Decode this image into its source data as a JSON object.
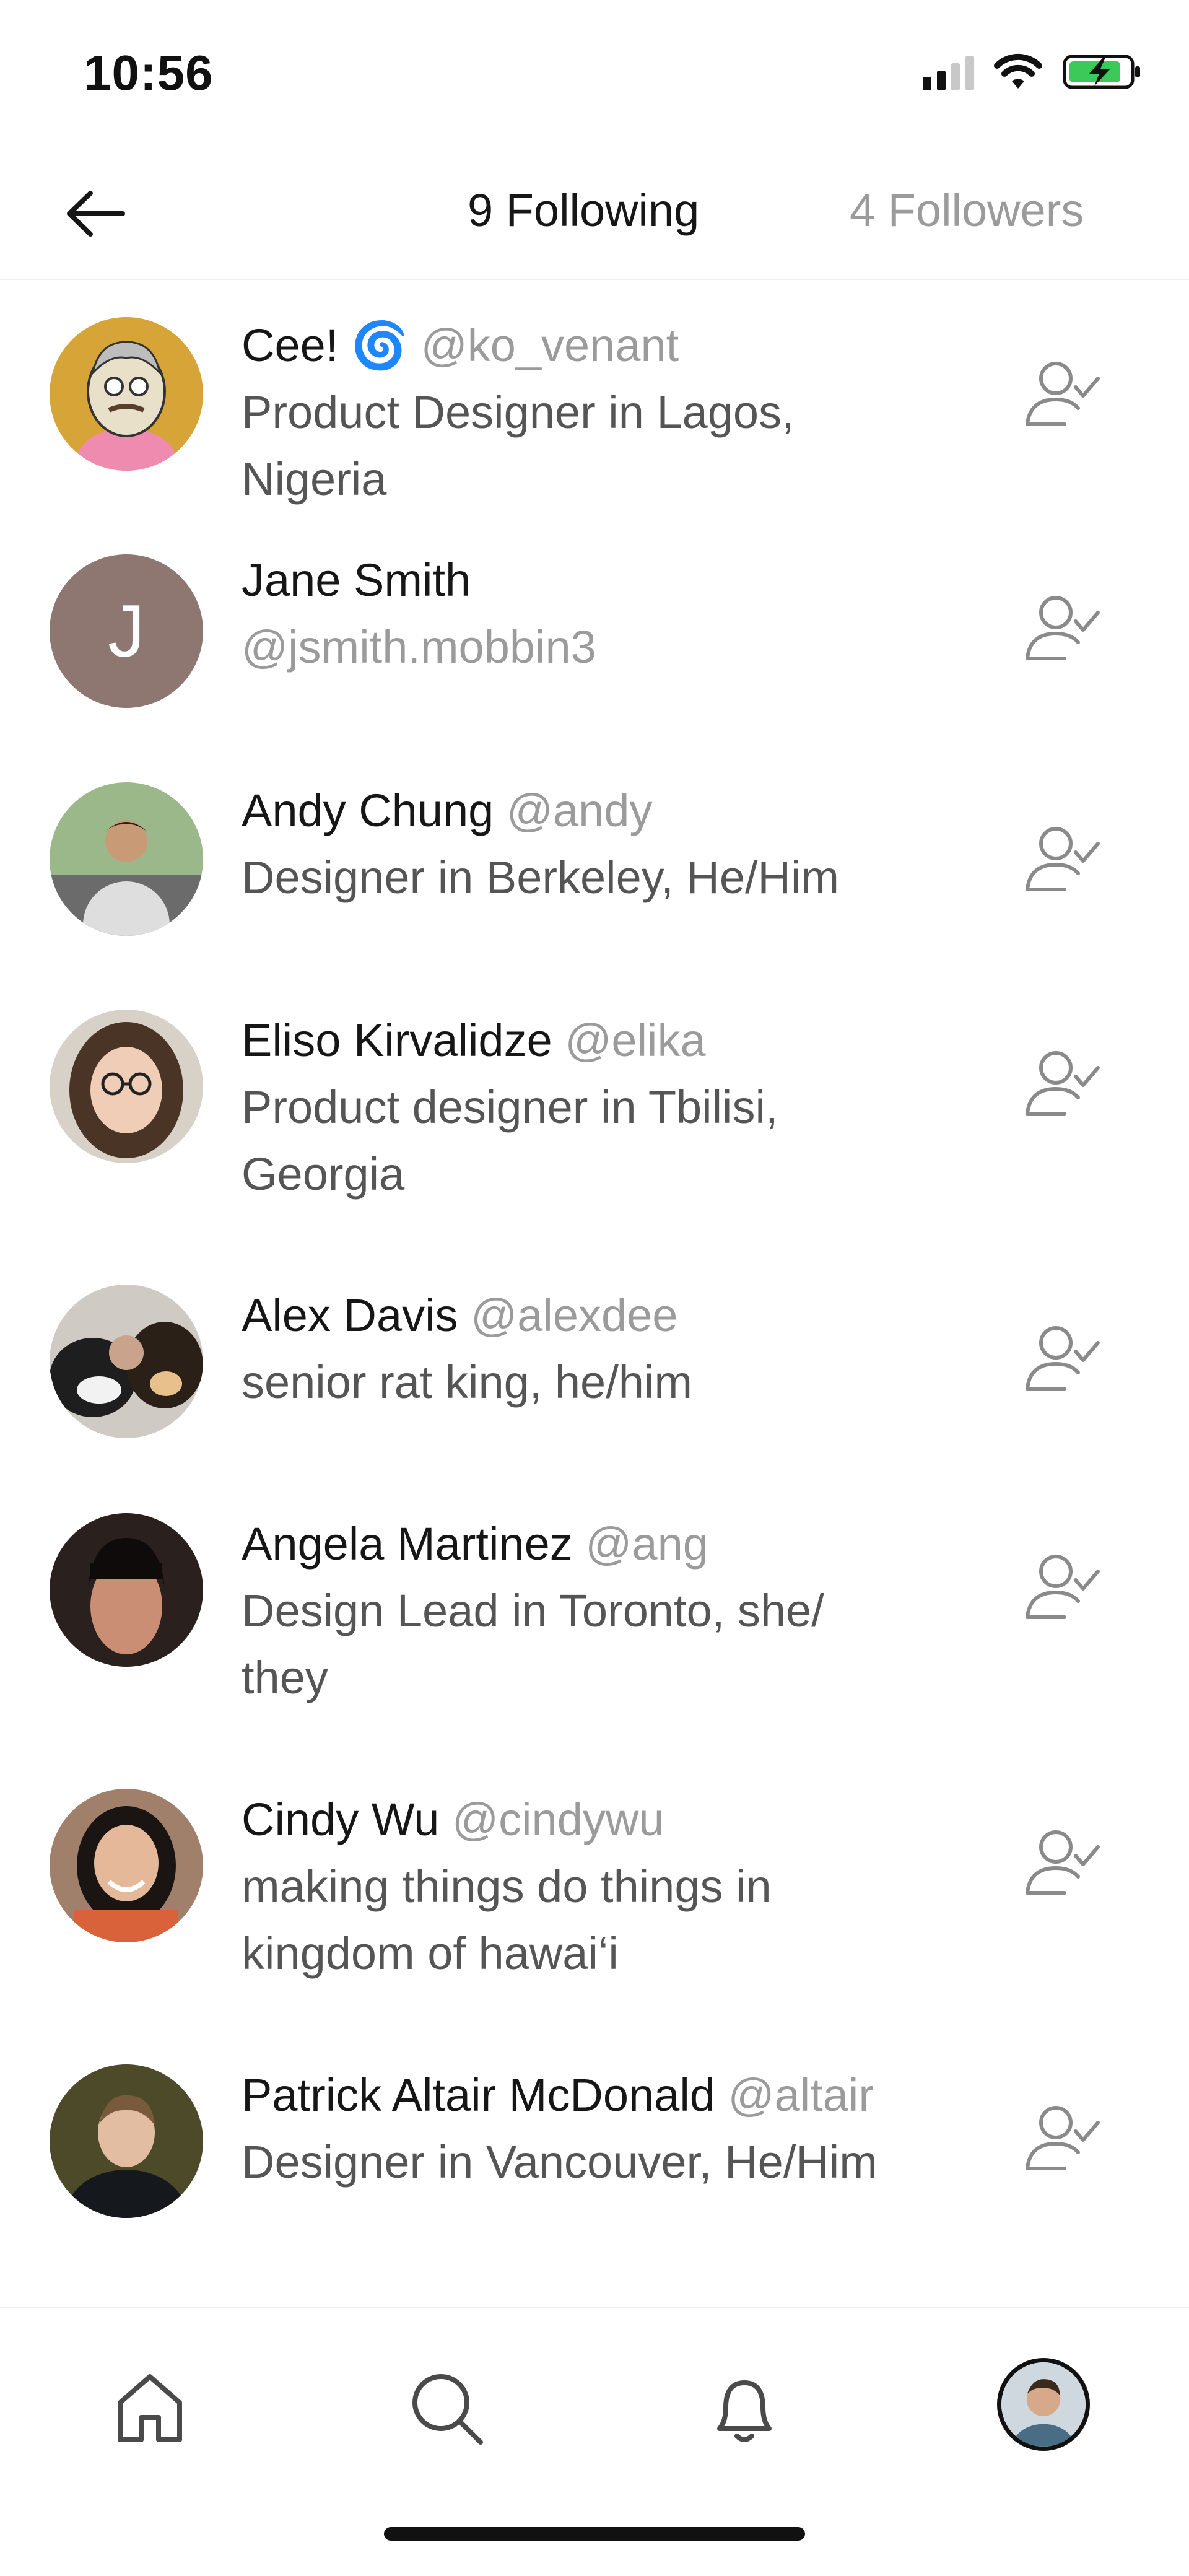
{
  "status_bar": {
    "time": "10:56",
    "signal_icon": "cellular-signal-icon",
    "wifi_icon": "wifi-icon",
    "battery_icon": "battery-charging-icon"
  },
  "header": {
    "back_icon": "arrow-left-icon",
    "following_label": "9 Following",
    "followers_label": "4 Followers"
  },
  "following": [
    {
      "name": "Cee! 🌀",
      "handle": "@ko_venant",
      "bio_lines": [
        "Product Designer in Lagos,",
        "Nigeria"
      ]
    },
    {
      "name": "Jane Smith",
      "handle": "@jsmith.mobbin3",
      "initial": "J",
      "bio_lines": []
    },
    {
      "name": "Andy Chung",
      "handle": "@andy",
      "bio_lines": [
        "Designer in Berkeley, He/Him"
      ]
    },
    {
      "name": "Eliso Kirvalidze",
      "handle": "@elika",
      "bio_lines": [
        "Product designer in Tbilisi,",
        "Georgia"
      ]
    },
    {
      "name": "Alex Davis",
      "handle": "@alexdee",
      "bio_lines": [
        "senior rat king, he/him"
      ]
    },
    {
      "name": "Angela Martinez",
      "handle": "@ang",
      "bio_lines": [
        "Design Lead in Toronto, she/",
        "they"
      ]
    },
    {
      "name": "Cindy Wu",
      "handle": "@cindywu",
      "bio_lines": [
        "making things do things in",
        "kingdom of hawai‘i"
      ]
    },
    {
      "name": "Patrick Altair McDonald",
      "handle": "@altair",
      "bio_lines": [
        "Designer in Vancouver, He/Him"
      ]
    }
  ],
  "tab_bar": {
    "items": [
      "home-icon",
      "search-icon",
      "bell-icon",
      "profile-avatar"
    ]
  },
  "colors": {
    "text": "#161616",
    "muted": "#9b9b9b",
    "bio": "#555555",
    "icon": "#8a8a8a",
    "initial_avatar_bg": "#8e7671"
  }
}
